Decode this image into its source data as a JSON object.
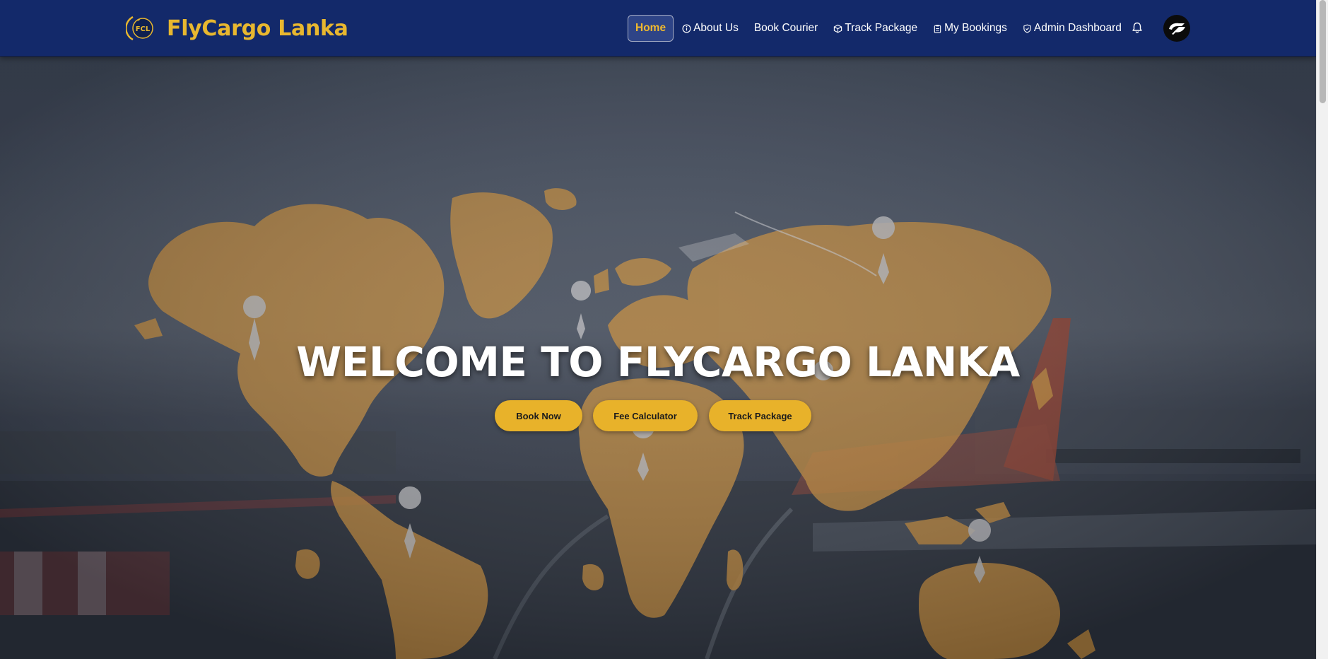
{
  "brand": {
    "name": "FlyCargo Lanka",
    "logo_text": "FCL",
    "color": "#e8b72f"
  },
  "navbar": {
    "background": "#13296a",
    "items": [
      {
        "label": "Home",
        "icon": "",
        "active": true
      },
      {
        "label": "About Us",
        "icon": "info-circle-icon",
        "active": false
      },
      {
        "label": "Book Courier",
        "icon": "",
        "active": false
      },
      {
        "label": "Track Package",
        "icon": "box-icon",
        "active": false
      },
      {
        "label": "My Bookings",
        "icon": "clipboard-icon",
        "active": false
      },
      {
        "label": "Admin Dashboard",
        "icon": "shield-icon",
        "active": false
      }
    ],
    "notification_icon": "bell-icon",
    "avatar_icon": "avatar-icon"
  },
  "hero": {
    "title": "WELCOME TO FLYCARGO LANKA",
    "map_color": "#e5a13f",
    "buttons": [
      {
        "label": "Book Now"
      },
      {
        "label": "Fee Calculator"
      },
      {
        "label": "Track Package"
      }
    ],
    "button_color": "#e8b22a"
  }
}
